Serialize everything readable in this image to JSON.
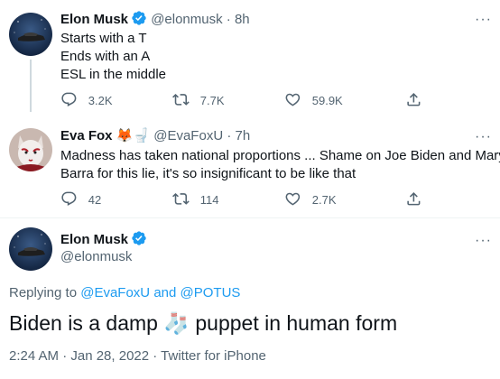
{
  "tweets": [
    {
      "name": "Elon Musk",
      "handle": "@elonmusk",
      "time": "8h",
      "lines": [
        "Starts with a T",
        "Ends with an A",
        "ESL in the middle"
      ],
      "replies": "3.2K",
      "retweets": "7.7K",
      "likes": "59.9K"
    },
    {
      "name": "Eva Fox",
      "name_emoji": "🦊🚽",
      "handle": "@EvaFoxU",
      "time": "7h",
      "lines": [
        "Madness has taken national proportions ... Shame on Joe Biden and Mary",
        "Barra for this lie, it's so insignificant to be like that"
      ],
      "replies": "42",
      "retweets": "114",
      "likes": "2.7K"
    }
  ],
  "focus": {
    "name": "Elon Musk",
    "handle": "@elonmusk",
    "replying_prefix": "Replying to",
    "replying_to_1": "@EvaFoxU",
    "replying_and": "and",
    "replying_to_2": "@POTUS",
    "text_before": "Biden is a damp",
    "text_emoji": "🧦",
    "text_after": "puppet in human form",
    "timestamp": "2:24 AM · Jan 28, 2022 · Twitter for iPhone"
  },
  "common": {
    "dot": "·",
    "more": "···"
  },
  "colors": {
    "accent": "#1d9bf0",
    "secondary_text": "#536471",
    "divider": "#eff3f4",
    "verified": "#1d9bf0"
  }
}
